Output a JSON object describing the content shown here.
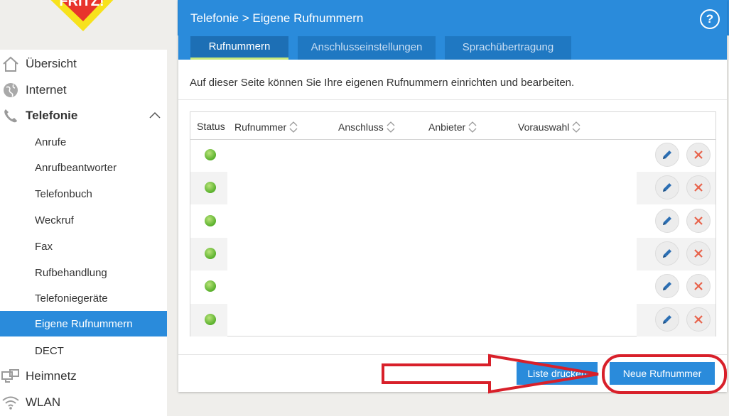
{
  "logo": {
    "text": "FRITZ!"
  },
  "sidebar": {
    "items": [
      {
        "label": "Übersicht",
        "icon": "home-icon"
      },
      {
        "label": "Internet",
        "icon": "globe-icon"
      },
      {
        "label": "Telefonie",
        "icon": "phone-icon"
      },
      {
        "label": "Anrufe"
      },
      {
        "label": "Anrufbeantworter"
      },
      {
        "label": "Telefonbuch"
      },
      {
        "label": "Weckruf"
      },
      {
        "label": "Fax"
      },
      {
        "label": "Rufbehandlung"
      },
      {
        "label": "Telefoniegeräte"
      },
      {
        "label": "Eigene Rufnummern"
      },
      {
        "label": "DECT"
      },
      {
        "label": "Heimnetz",
        "icon": "network-icon"
      },
      {
        "label": "WLAN",
        "icon": "wifi-icon"
      }
    ]
  },
  "header": {
    "breadcrumb": "Telefonie > Eigene Rufnummern",
    "help_icon": "?"
  },
  "tabs": [
    {
      "label": "Rufnummern",
      "active": true
    },
    {
      "label": "Anschlusseinstellungen"
    },
    {
      "label": "Sprachübertragung"
    }
  ],
  "intro": "Auf dieser Seite können Sie Ihre eigenen Rufnummern einrichten und bearbeiten.",
  "table": {
    "columns": [
      "Status",
      "Rufnummer",
      "Anschluss",
      "Anbieter",
      "Vorauswahl"
    ],
    "row_count": 6,
    "status_color": "#58b02b"
  },
  "buttons": {
    "print": "Liste drucken",
    "new": "Neue Rufnummer"
  },
  "colors": {
    "accent": "#2a8bdb",
    "annotation": "#d8202a"
  }
}
